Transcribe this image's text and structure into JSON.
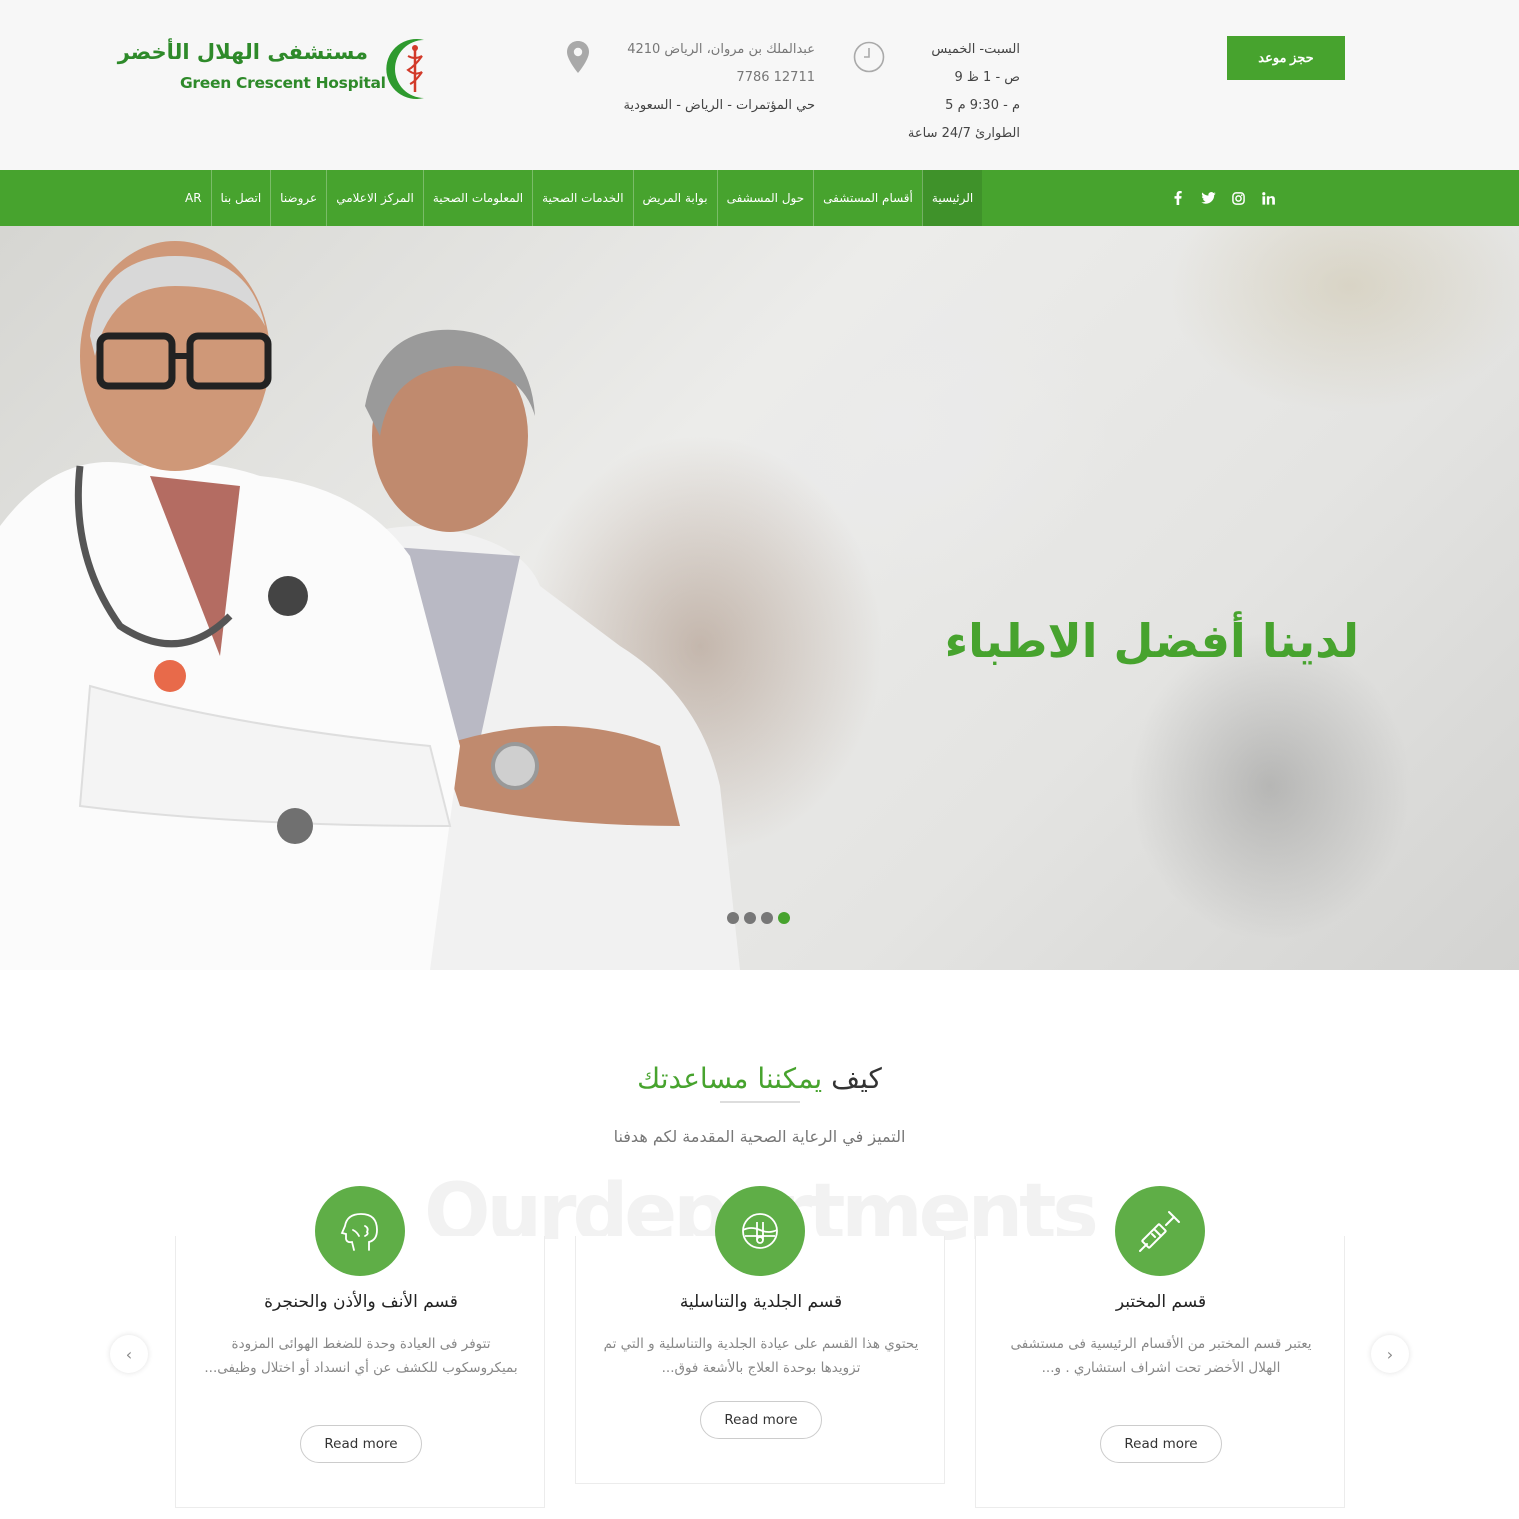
{
  "colors": {
    "brand_green": "#47a32e",
    "icon_green": "#5fae47",
    "topbar_bg": "#f7f7f7"
  },
  "header": {
    "logo": {
      "arabic": "مستشفى الهلال الأخضر",
      "english": "Green Crescent Hospital",
      "icon": "crescent-caduceus-icon"
    },
    "address": {
      "line1": "عبدالملك بن مروان، الرياض 4210",
      "line2": "7786 12711",
      "line3": "حي المؤتمرات - الرياض - السعودية",
      "icon": "map-pin-icon"
    },
    "hours": {
      "line1": "السبت- الخميس",
      "line2": "ص - 1 ظ 9",
      "line3": "م - 9:30 م 5",
      "line4": "الطوارئ 24/7 ساعة",
      "icon": "clock-icon"
    },
    "book_button": "حجز موعد"
  },
  "nav": {
    "items": [
      {
        "label": "الرئيسية",
        "active": true
      },
      {
        "label": "أقسام المستشفى"
      },
      {
        "label": "حول المسشفى"
      },
      {
        "label": "بوابة المريض"
      },
      {
        "label": "الخدمات الصحية"
      },
      {
        "label": "المعلومات الصحية"
      },
      {
        "label": "المركز الاعلامي"
      },
      {
        "label": "عروضنا"
      },
      {
        "label": "اتصل بنا"
      },
      {
        "label": "AR"
      }
    ],
    "socials": [
      {
        "name": "facebook-icon",
        "glyph": "f"
      },
      {
        "name": "twitter-icon",
        "glyph": "t"
      },
      {
        "name": "instagram-icon",
        "glyph": "◎"
      },
      {
        "name": "linkedin-icon",
        "glyph": "in"
      }
    ]
  },
  "hero": {
    "title": "لدينا أفضل الاطباء",
    "slide_count": 4,
    "active_slide": 4
  },
  "departments": {
    "title_part1": "كيف ",
    "title_part2": "يمكننا مساعدتك",
    "subtitle": "التميز في الرعاية الصحية المقدمة لكم هدفنا",
    "watermark": "Ourdepartments",
    "cards": [
      {
        "title": "قسم المختبر",
        "text": "يعتبر قسم المختبر من الأقسام الرئيسية فى مستشفى الهلال الأخضر تحت اشراف استشاري . و...",
        "button": "Read more",
        "icon": "syringe-icon"
      },
      {
        "title": "قسم الجلدية والتناسلية",
        "text": "يحتوي هذا القسم على عيادة الجلدية والتناسلية و التي تم تزويدها بوحدة العلاج بالأشعة فوق...",
        "button": "Read more",
        "icon": "skin-layers-icon"
      },
      {
        "title": "قسم الأنف والأذن والحنجرة",
        "text": "تتوفر فى العيادة وحدة للضغط الهوائى المزودة بميكروسكوب للكشف عن أي انسداد أو اختلال وظيفى...",
        "button": "Read more",
        "icon": "head-profile-icon"
      }
    ]
  },
  "carousel": {
    "prev_glyph": "‹",
    "next_glyph": "›"
  }
}
